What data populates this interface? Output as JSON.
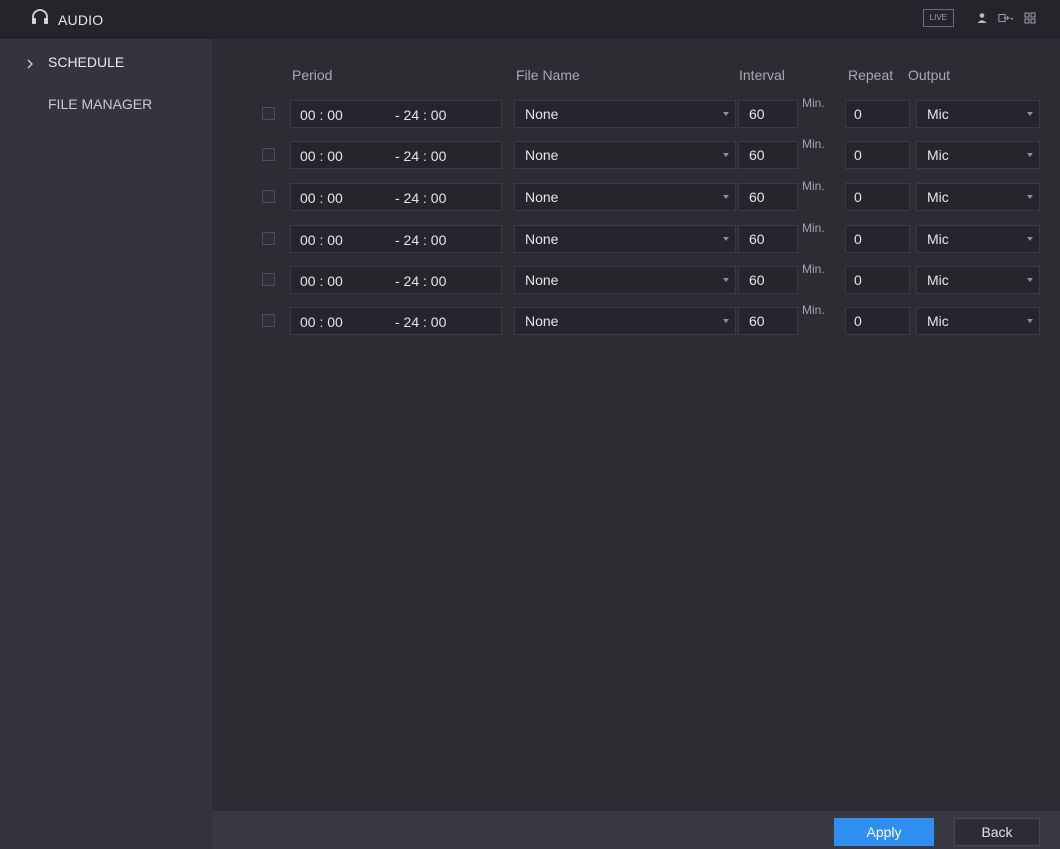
{
  "header": {
    "title": "AUDIO",
    "live_label": "LIVE",
    "icons": [
      "headphones-icon",
      "user-icon",
      "logout-icon",
      "grid-menu-icon"
    ]
  },
  "sidebar": {
    "items": [
      {
        "label": "SCHEDULE",
        "active": true
      },
      {
        "label": "FILE MANAGER",
        "active": false
      }
    ]
  },
  "table": {
    "headers": {
      "period": "Period",
      "file_name": "File Name",
      "interval": "Interval",
      "repeat": "Repeat",
      "output": "Output"
    },
    "rows": [
      {
        "checked": false,
        "start": "00 : 00",
        "end": "- 24 : 00",
        "file": "None",
        "interval": "60",
        "unit": "Min.",
        "repeat": "0",
        "output": "Mic"
      },
      {
        "checked": false,
        "start": "00 : 00",
        "end": "- 24 : 00",
        "file": "None",
        "interval": "60",
        "unit": "Min.",
        "repeat": "0",
        "output": "Mic"
      },
      {
        "checked": false,
        "start": "00 : 00",
        "end": "- 24 : 00",
        "file": "None",
        "interval": "60",
        "unit": "Min.",
        "repeat": "0",
        "output": "Mic"
      },
      {
        "checked": false,
        "start": "00 : 00",
        "end": "- 24 : 00",
        "file": "None",
        "interval": "60",
        "unit": "Min.",
        "repeat": "0",
        "output": "Mic"
      },
      {
        "checked": false,
        "start": "00 : 00",
        "end": "- 24 : 00",
        "file": "None",
        "interval": "60",
        "unit": "Min.",
        "repeat": "0",
        "output": "Mic"
      },
      {
        "checked": false,
        "start": "00 : 00",
        "end": "- 24 : 00",
        "file": "None",
        "interval": "60",
        "unit": "Min.",
        "repeat": "0",
        "output": "Mic"
      }
    ]
  },
  "footer": {
    "apply_label": "Apply",
    "back_label": "Back"
  },
  "colors": {
    "accent": "#2e8ff0",
    "background": "#2c2d33",
    "sidebar": "#34353c"
  }
}
